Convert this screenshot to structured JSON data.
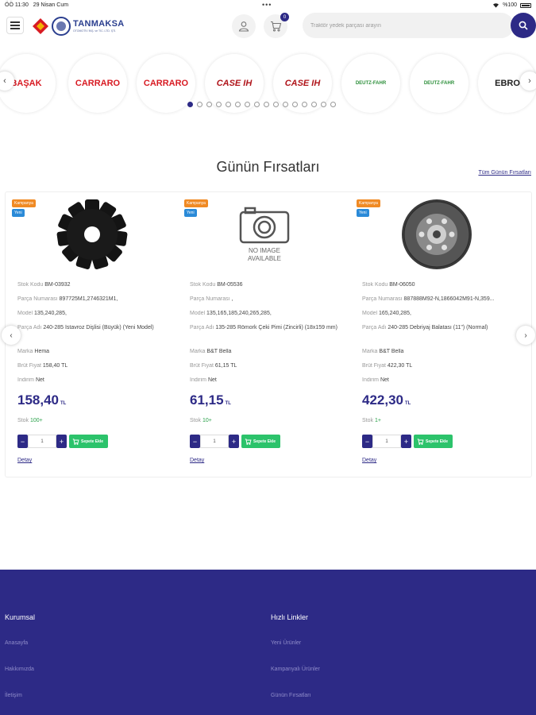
{
  "status_bar": {
    "time": "ÖÖ 11:30",
    "date": "29 Nisan Cum",
    "battery": "%100"
  },
  "header": {
    "logo_name": "TANMAKSA",
    "logo_subtitle": "OTOMOTİV İNŞ. ve TİC. LTD. ŞTİ.",
    "cart_count": "0",
    "search_placeholder": "Traktör yedek parçası arayın"
  },
  "brands": [
    {
      "name": "BAŞAK",
      "color": "#d81b23"
    },
    {
      "name": "CARRARO",
      "color": "#d81b23"
    },
    {
      "name": "CARRARO",
      "color": "#d81b23"
    },
    {
      "name": "CASE IH",
      "color": "#b0151b"
    },
    {
      "name": "CASE IH",
      "color": "#b0151b"
    },
    {
      "name": "DEUTZ-FAHR",
      "color": "#2c8f3a"
    },
    {
      "name": "DEUTZ-FAHR",
      "color": "#2c8f3a"
    },
    {
      "name": "EBRO",
      "color": "#222222"
    }
  ],
  "pager": {
    "count": 16,
    "active": 0
  },
  "deals": {
    "title": "Günün Fırsatları",
    "all_link": "Tüm Günün Fırsatları",
    "labels": {
      "stok_kodu": "Stok Kodu",
      "parca_numarasi": "Parça Numarası",
      "model": "Model",
      "parca_adi": "Parça Adı",
      "marka": "Marka",
      "brut_fiyat": "Brüt Fiyat",
      "indirim": "İndirim",
      "stok": "Stok",
      "currency": "TL",
      "add_to_cart": "Sepete Ekle",
      "detay": "Detay",
      "badge_kampanya": "Kampanya",
      "badge_yeni": "Yeni"
    },
    "products": [
      {
        "stok_kodu": "BM-03932",
        "parca_numarasi": "897725M1,2746321M1,",
        "model": "135,240,285,",
        "parca_adi": "240-285 İstavroz Dişlisi (Büyük) (Yeni Model)",
        "marka": "Hema",
        "brut_fiyat": "158,40 TL",
        "indirim": "Net",
        "price": "158,40",
        "stok": "100+",
        "qty": "1",
        "image": "gear"
      },
      {
        "stok_kodu": "BM-05536",
        "parca_numarasi": ",",
        "model": "135,165,185,240,265,285,",
        "parca_adi": "135-285 Römork Çeki Pimi (Zincirli) (18x159 mm)",
        "marka": "B&T Bella",
        "brut_fiyat": "61,15 TL",
        "indirim": "Net",
        "price": "61,15",
        "stok": "10+",
        "qty": "1",
        "image": "no-image",
        "no_image_text": "NO IMAGE AVAILABLE"
      },
      {
        "stok_kodu": "BM-06050",
        "parca_numarasi": "887888M92-N,1866042M91-N,359...",
        "model": "165,240,285,",
        "parca_adi": "240-285 Debriyaj Balatası (11\") (Normal)",
        "marka": "B&T Bella",
        "brut_fiyat": "422,30 TL",
        "indirim": "Net",
        "price": "422,30",
        "stok": "1+",
        "qty": "1",
        "image": "clutch-disc"
      }
    ]
  },
  "footer": {
    "kurumsal": {
      "title": "Kurumsal",
      "links": [
        "Anasayfa",
        "Hakkımızda",
        "İletişim"
      ]
    },
    "hizli": {
      "title": "Hızlı Linkler",
      "links": [
        "Yeni Ürünler",
        "Kampanyalı Ürünler",
        "Günün Fırsatları"
      ]
    }
  },
  "colors": {
    "primary": "#2d2a86",
    "add_to_cart": "#2cc36b",
    "badge_kampanya": "#f08a24",
    "badge_yeni": "#2a8ad8"
  }
}
